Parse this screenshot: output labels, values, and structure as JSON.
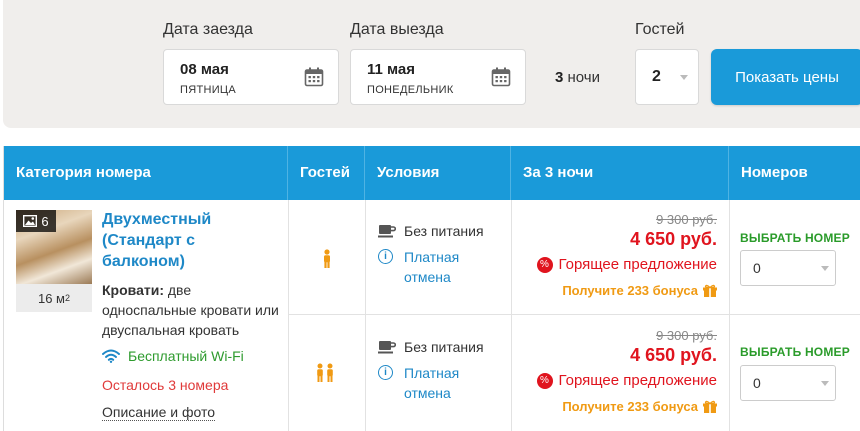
{
  "search": {
    "checkin_label": "Дата заезда",
    "checkin_date": "08 мая",
    "checkin_weekday": "ПЯТНИЦА",
    "checkout_label": "Дата выезда",
    "checkout_date": "11 мая",
    "checkout_weekday": "ПОНЕДЕЛЬНИК",
    "nights_count": "3",
    "nights_word": "ночи",
    "guests_label": "Гостей",
    "guests_value": "2",
    "show_prices_button": "Показать цены"
  },
  "table": {
    "headers": [
      "Категория номера",
      "Гостей",
      "Условия",
      "За 3 ночи",
      "Номеров"
    ]
  },
  "room": {
    "photo_count": "6",
    "area_value": "16 м",
    "area_unit_sup": "2",
    "name": "Двухместный (Стандарт с балконом)",
    "beds_label": "Кровати:",
    "beds_text": " две односпальные кровати или двуспальная кровать",
    "wifi": "Бесплатный Wi-Fi",
    "remaining": "Осталось 3 номера",
    "description_link": "Описание и фото"
  },
  "offers": [
    {
      "guests": 1,
      "meal": "Без питания",
      "cancellation": "Платная отмена",
      "old_price": "9 300 руб.",
      "price": "4 650 руб.",
      "hot_deal": "Горящее предложение",
      "bonus": "Получите 233 бонуса",
      "choose_label": "ВЫБРАТЬ НОМЕР",
      "rooms_selected": "0"
    },
    {
      "guests": 2,
      "meal": "Без питания",
      "cancellation": "Платная отмена",
      "old_price": "9 300 руб.",
      "price": "4 650 руб.",
      "hot_deal": "Горящее предложение",
      "bonus": "Получите 233 бонуса",
      "choose_label": "ВЫБРАТЬ НОМЕР",
      "rooms_selected": "0"
    }
  ],
  "icons": {
    "calendar": "calendar-icon",
    "image": "image-icon",
    "wifi": "wifi-icon",
    "meal": "cup-icon",
    "info": "info-icon",
    "hot": "percent-icon",
    "gift": "gift-icon",
    "person": "person-icon"
  },
  "colors": {
    "accent": "#1a9ad9",
    "price_red": "#e0141e",
    "green": "#2a9b2a",
    "bonus_orange": "#f09a13",
    "guest_orange": "#f09a13"
  }
}
